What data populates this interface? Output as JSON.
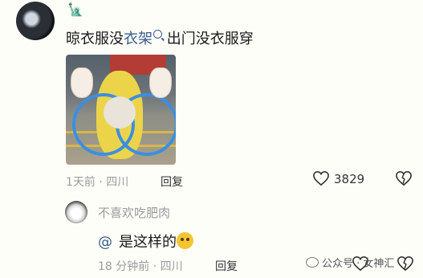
{
  "comment": {
    "text_before_link": "晾衣服没",
    "link_text": "衣架",
    "text_after_link": " 出门没衣服穿",
    "time": "1天前",
    "location": "四川",
    "reply_label": "回复",
    "like_count": "3829"
  },
  "reply": {
    "username": "不喜欢吃肥肉",
    "at_symbol": "@",
    "text": "是这样的",
    "time": "18 分钟前",
    "location": "四川",
    "reply_label": "回复"
  },
  "watermark": {
    "source": "公众号",
    "name": "女神汇"
  },
  "icons": {
    "badge": "statue-of-liberty-icon",
    "search": "search-icon",
    "like": "heart-icon",
    "dislike": "dislike-heart-icon",
    "emoji": "smiling-face-icon"
  }
}
